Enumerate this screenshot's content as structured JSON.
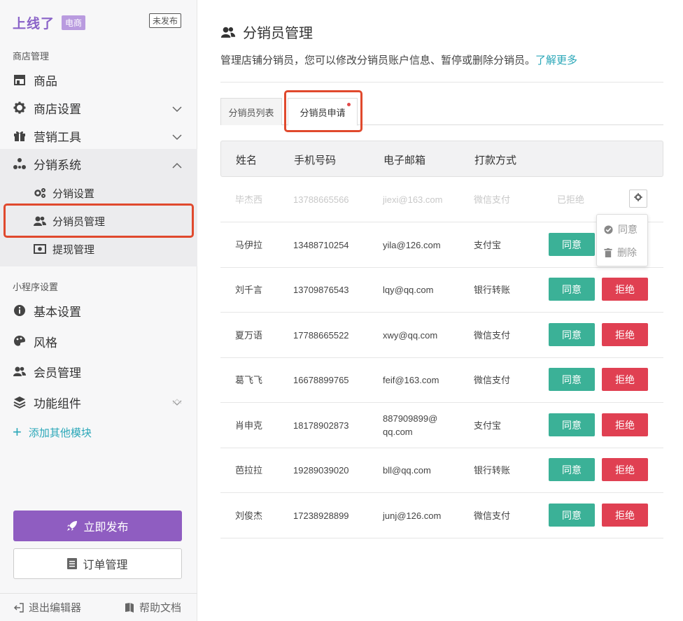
{
  "sidebar": {
    "brand_logo": "上线了",
    "brand_tag": "电商",
    "status_badge": "未发布",
    "group_store": "商店管理",
    "items": {
      "products": "商品",
      "store_settings": "商店设置",
      "marketing": "营销工具",
      "distribution": "分销系统",
      "dist_settings": "分销设置",
      "dist_manage": "分销员管理",
      "withdraw": "提现管理"
    },
    "group_miniapp": "小程序设置",
    "mini_items": {
      "basic": "基本设置",
      "style": "风格",
      "members": "会员管理",
      "components": "功能组件"
    },
    "add_module": "添加其他模块",
    "publish_label": "立即发布",
    "orders_label": "订单管理",
    "exit_label": "退出编辑器",
    "help_label": "帮助文档"
  },
  "main": {
    "title": "分销员管理",
    "description": "管理店铺分销员，您可以修改分销员账户信息、暂停或删除分销员。",
    "learn_more": "了解更多",
    "tabs": {
      "list": "分销员列表",
      "apply": "分销员申请"
    },
    "columns": {
      "name": "姓名",
      "phone": "手机号码",
      "email": "电子邮箱",
      "payment": "打款方式"
    },
    "rejected_row": {
      "name": "毕杰西",
      "phone": "13788665566",
      "email": "jiexi@163.com",
      "payment": "微信支付",
      "status": "已拒绝"
    },
    "rows": [
      {
        "name": "马伊拉",
        "phone": "13488710254",
        "email": "yila@126.com",
        "payment": "支付宝"
      },
      {
        "name": "刘千言",
        "phone": "13709876543",
        "email": "lqy@qq.com",
        "payment": "银行转账"
      },
      {
        "name": "夏万语",
        "phone": "17788665522",
        "email": "xwy@qq.com",
        "payment": "微信支付"
      },
      {
        "name": "葛飞飞",
        "phone": "16678899765",
        "email": "feif@163.com",
        "payment": "微信支付"
      },
      {
        "name": "肖申克",
        "phone": "18178902873",
        "email_line1": "887909899@",
        "email_line2": "qq.com",
        "payment": "支付宝"
      },
      {
        "name": "芭拉拉",
        "phone": "19289039020",
        "email": "bll@qq.com",
        "payment": "银行转账"
      },
      {
        "name": "刘俊杰",
        "phone": "17238928899",
        "email": "junj@126.com",
        "payment": "微信支付"
      }
    ],
    "agree_label": "同意",
    "reject_label": "拒绝",
    "dropdown": {
      "agree": "同意",
      "delete": "删除"
    }
  },
  "colors": {
    "brand_purple": "#8f5dc1",
    "accent_teal": "#2aa7b8",
    "agree_green": "#3bb197",
    "reject_red": "#e04052",
    "highlight_red": "#e0492d"
  },
  "icons": [
    "store-icon",
    "gear-icon",
    "gift-icon",
    "sitemap-icon",
    "gears-icon",
    "users-icon",
    "money-icon",
    "info-icon",
    "palette-icon",
    "stack-icon",
    "rocket-icon",
    "document-icon",
    "exit-icon",
    "book-icon",
    "check-circle-icon",
    "trash-icon",
    "chevron-down-icon",
    "chevron-up-icon"
  ]
}
